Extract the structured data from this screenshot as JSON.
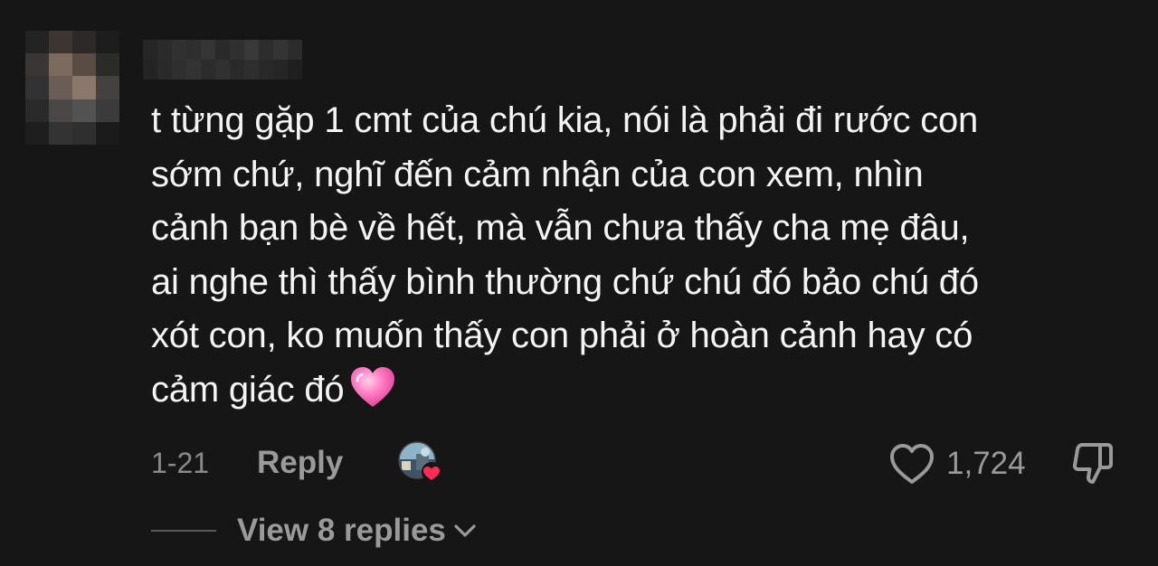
{
  "comment": {
    "lines": [
      "t từng gặp 1 cmt của chú kia, nói là phải đi rước con",
      "sớm chứ, nghĩ đến cảm nhận của con xem, nhìn",
      "cảnh bạn bè về hết, mà vẫn chưa thấy cha mẹ đâu,",
      "ai nghe thì thấy bình thường chứ chú đó bảo chú đó",
      "xót con, ko muốn thấy con phải ở hoàn cảnh hay có",
      "cảm giác đó"
    ],
    "emoji": "pink-heart-emoji"
  },
  "meta": {
    "date": "1-21",
    "reply_label": "Reply",
    "like_count": "1,724",
    "view_replies_label": "View 8 replies"
  },
  "icons": {
    "like": "heart-outline-icon",
    "dislike": "thumbs-down-icon",
    "chevron": "chevron-down-icon",
    "liked_by_creator_badge": "red-heart-icon"
  },
  "colors": {
    "background": "#161616",
    "text_primary": "#f4f4f4",
    "text_secondary": "#9a9a9a",
    "heart_red": "#fe2c55"
  }
}
